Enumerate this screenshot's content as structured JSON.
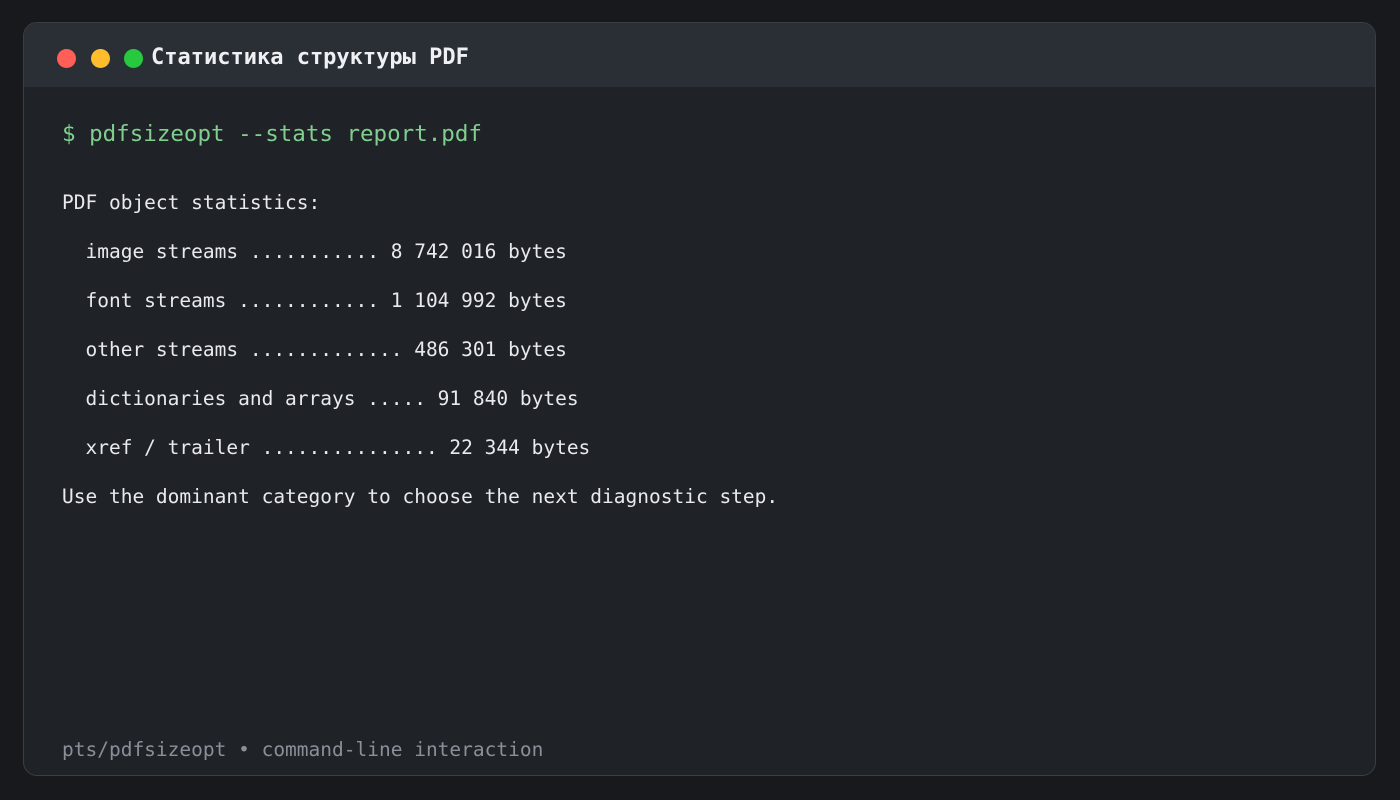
{
  "window": {
    "title": "Статистика структуры PDF",
    "controls": {
      "close_color": "#ff5f56",
      "minimize_color": "#ffbd2e",
      "maximize_color": "#27c93f"
    }
  },
  "terminal": {
    "prompt": "$ pdfsizeopt --stats report.pdf",
    "header": "PDF object statistics:",
    "stats": [
      {
        "text": "  image streams ........... 8 742 016 bytes"
      },
      {
        "text": "  font streams ............ 1 104 992 bytes"
      },
      {
        "text": "  other streams ............. 486 301 bytes"
      },
      {
        "text": "  dictionaries and arrays ..... 91 840 bytes"
      },
      {
        "text": "  xref / trailer ............... 22 344 bytes"
      }
    ],
    "advice": "Use the dominant category to choose the next diagnostic step."
  },
  "footer": {
    "text": "pts/pdfsizeopt • command-line interaction"
  },
  "colors": {
    "background": "#17191d",
    "window": "#1f2227",
    "titlebar": "#2a2e35",
    "prompt": "#7fcf8e",
    "text": "#e8eaed",
    "muted": "#8a8f98"
  }
}
